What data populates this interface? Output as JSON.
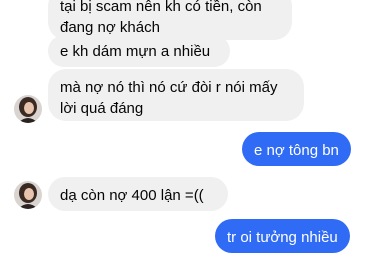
{
  "conversation": {
    "messages": [
      {
        "direction": "incoming",
        "lines": [
          "tại bị scam nên kh có tiền, còn",
          "đang nợ khách"
        ]
      },
      {
        "direction": "incoming",
        "lines": [
          "e kh dám mựn a nhiều"
        ]
      },
      {
        "direction": "incoming",
        "lines": [
          "mà nợ nó thì nó cứ đòi r nói mấy",
          "lời quá đáng"
        ]
      },
      {
        "direction": "outgoing",
        "lines": [
          "e nợ tông bn"
        ]
      },
      {
        "direction": "incoming",
        "lines": [
          "dạ còn nợ 400 lận =(("
        ]
      },
      {
        "direction": "outgoing",
        "lines": [
          "tr oi tưởng nhiều"
        ]
      }
    ]
  },
  "colors": {
    "incoming_bubble": "#f0f0f0",
    "outgoing_bubble": "#2f6bf5",
    "background": "#ffffff"
  }
}
